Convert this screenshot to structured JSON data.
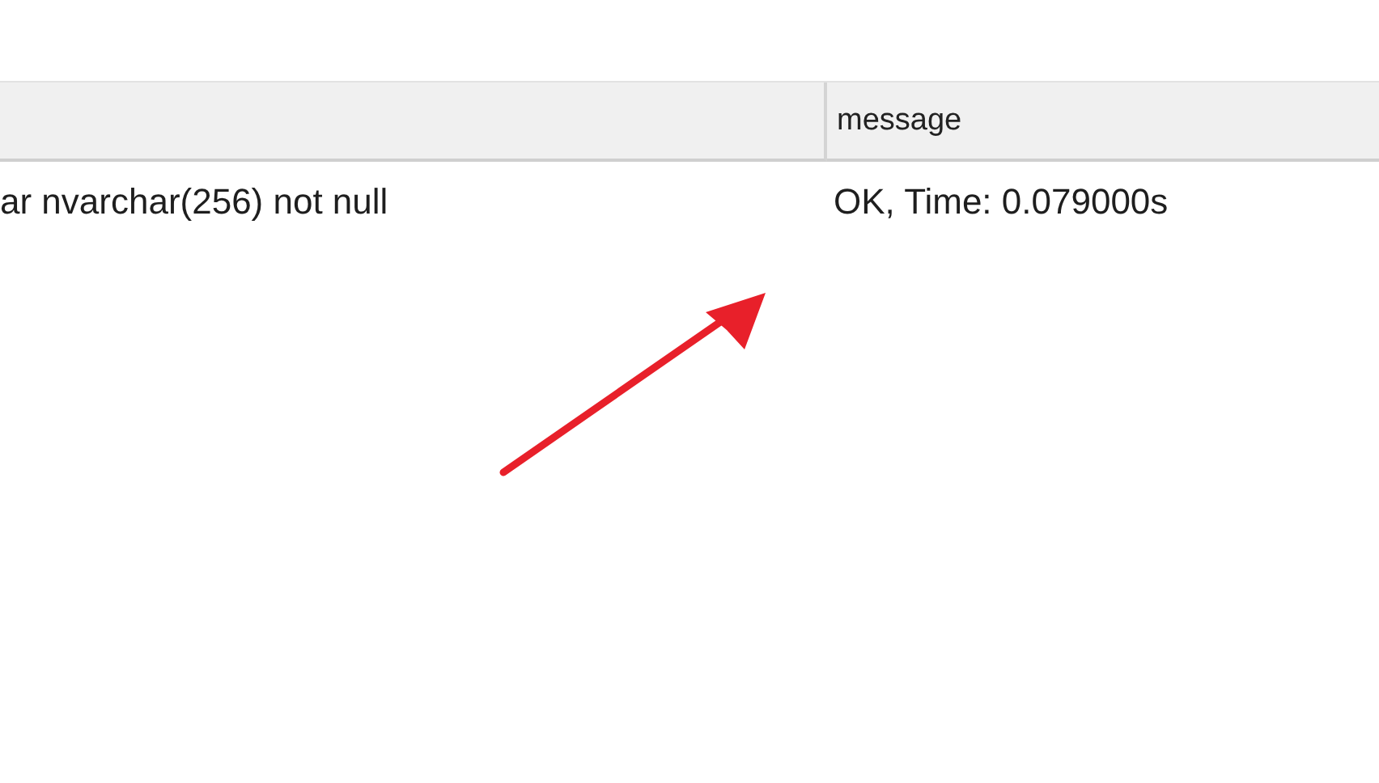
{
  "table": {
    "columns": [
      {
        "label": "message"
      }
    ],
    "rows": [
      {
        "column_1": "ar nvarchar(256) not null",
        "message": "OK, Time: 0.079000s"
      }
    ]
  },
  "annotations": [
    {
      "kind": "arrow",
      "color": "#e8202a"
    }
  ]
}
